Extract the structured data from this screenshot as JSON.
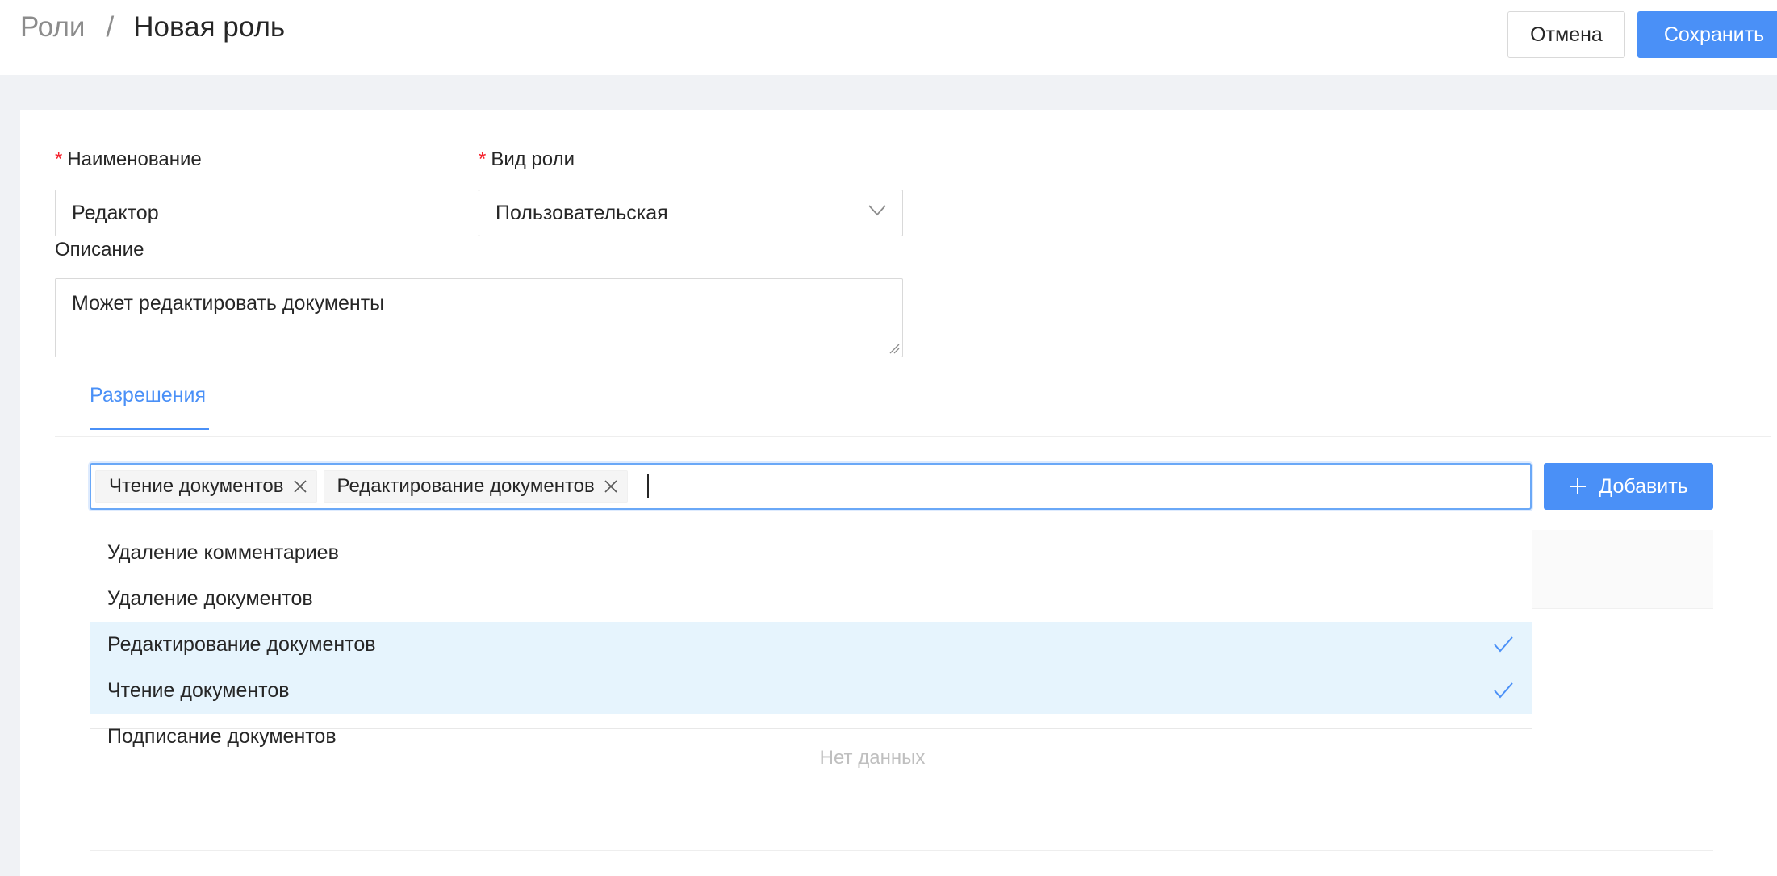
{
  "header": {
    "breadcrumb_parent": "Роли",
    "breadcrumb_separator": "/",
    "title": "Новая роль",
    "cancel_label": "Отмена",
    "save_label": "Сохранить"
  },
  "form": {
    "required_marker": "*",
    "name_label": "Наименование",
    "name_value": "Редактор",
    "type_label": "Вид роли",
    "type_value": "Пользовательская",
    "description_label": "Описание",
    "description_value": "Может редактировать документы"
  },
  "tabs": [
    {
      "label": "Разрешения",
      "active": true
    }
  ],
  "permissions": {
    "selected_tags": [
      "Чтение документов",
      "Редактирование документов"
    ],
    "add_label": "Добавить",
    "options": [
      {
        "label": "Удаление комментариев",
        "selected": false
      },
      {
        "label": "Удаление документов",
        "selected": false
      },
      {
        "label": "Редактирование документов",
        "selected": true
      },
      {
        "label": "Чтение документов",
        "selected": true
      },
      {
        "label": "Подписание документов",
        "selected": false
      }
    ],
    "empty_text": "Нет данных"
  },
  "colors": {
    "accent": "#4a90f7",
    "selected_option_bg": "#e6f4fd",
    "required": "#f5222d",
    "page_bg": "#f0f2f5"
  },
  "icons": [
    "chevron-down-icon",
    "close-icon",
    "plus-icon",
    "check-icon",
    "resize-handle-icon"
  ]
}
